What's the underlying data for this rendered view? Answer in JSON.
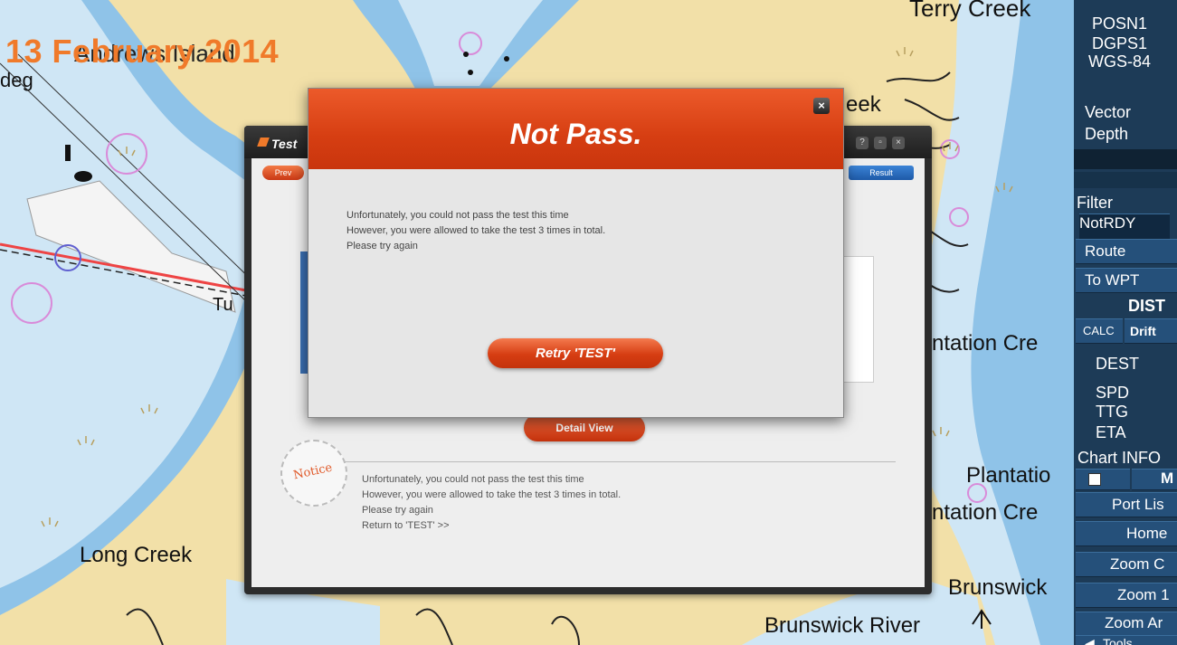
{
  "date_overlay": "13 February 2014",
  "map": {
    "labels": {
      "andrews_island": "Andrews Island",
      "edg": "deg",
      "terry_creek": "Terry Creek",
      "creek_fragment": "eek",
      "plantation_creek_1": "ntation Cre",
      "plantation": "Plantatio",
      "plantation_creek_2": "ntation Cre",
      "long_creek": "Long Creek",
      "brunswick": "Brunswick",
      "brunswick_river": "Brunswick River",
      "tu": "Tu"
    }
  },
  "side_panel": {
    "posn": "POSN1",
    "dgps": "DGPS1",
    "datum": "WGS-84",
    "vector": "Vector",
    "depth": "Depth",
    "filter": "Filter",
    "notrdy": "NotRDY",
    "route": "Route",
    "to_wpt": "To WPT",
    "dist": "DIST",
    "calc": "CALC",
    "drift": "Drift",
    "dest": "DEST",
    "spd": "SPD",
    "ttg": "TTG",
    "eta": "ETA",
    "chart_info": "Chart INFO",
    "m_label": "M",
    "port_list": "Port Lis",
    "home": "Home",
    "zoom_c": "Zoom C",
    "zoom_1": "Zoom 1",
    "zoom_a": "Zoom Ar",
    "tools": "Tools"
  },
  "test_window": {
    "title": "Test",
    "prev_label": "Prev",
    "result_label": "Result",
    "detail_view_label": "Detail View",
    "notice_stamp": "Notice",
    "notice_lines": [
      "Unfortunately, you could not pass the test this time",
      "However, you were allowed to take the test 3 times in total.",
      "Please try again",
      "Return to 'TEST' >>"
    ]
  },
  "modal": {
    "title": "Not Pass.",
    "close_label": "×",
    "message_lines": [
      "Unfortunately, you could not pass the test this time",
      "However, you were allowed to take the test 3 times in total.",
      "Please try again"
    ],
    "retry_label": "Retry 'TEST'"
  },
  "colors": {
    "accent_orange": "#d63e12",
    "panel_blue": "#1d3b57",
    "water_light": "#cfe6f5",
    "water_deep": "#8fc3e8",
    "land": "#f2e0a8"
  }
}
